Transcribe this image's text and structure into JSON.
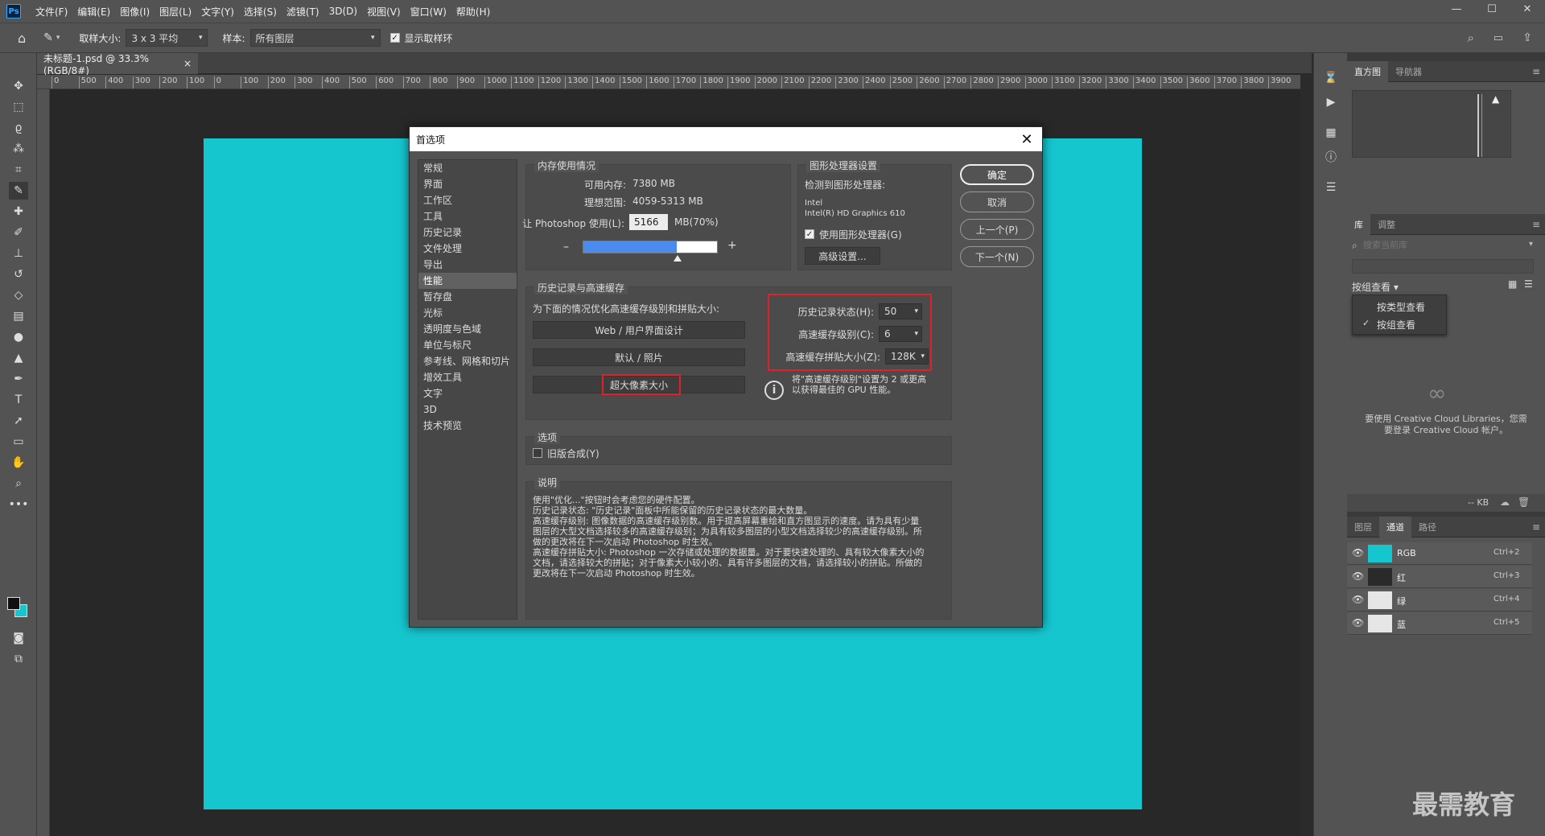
{
  "app": {
    "logo": "Ps",
    "menu": [
      "文件(F)",
      "编辑(E)",
      "图像(I)",
      "图层(L)",
      "文字(Y)",
      "选择(S)",
      "滤镜(T)",
      "3D(D)",
      "视图(V)",
      "窗口(W)",
      "帮助(H)"
    ]
  },
  "window_controls": {
    "minimize": "—",
    "maximize": "☐",
    "close": "✕"
  },
  "options": {
    "sample_size_label": "取样大小:",
    "sample_size_value": "3 x 3 平均",
    "sample_label": "样本:",
    "sample_value": "所有图层",
    "show_ring_label": "显示取样环"
  },
  "document_tab": {
    "title": "未标题-1.psd @ 33.3%(RGB/8#)",
    "close": "×"
  },
  "ruler_labels": [
    "0",
    "500",
    "400",
    "300",
    "200",
    "100",
    "0",
    "100",
    "200",
    "300",
    "400",
    "500",
    "600",
    "700",
    "800",
    "900",
    "1000",
    "1100",
    "1200",
    "1300",
    "1400",
    "1500",
    "1600",
    "1700",
    "1800",
    "1900",
    "2000",
    "2100",
    "2200",
    "2300",
    "2400",
    "2500",
    "2600",
    "2700",
    "2800",
    "2900",
    "3000",
    "3100",
    "3200",
    "3300",
    "3400",
    "3500",
    "3600",
    "3700",
    "3800",
    "3900"
  ],
  "canvas_color": "#16c6cf",
  "dialog": {
    "title": "首选项",
    "categories": [
      "常规",
      "界面",
      "工作区",
      "工具",
      "历史记录",
      "文件处理",
      "导出",
      "性能",
      "暂存盘",
      "光标",
      "透明度与色域",
      "单位与标尺",
      "参考线、网格和切片",
      "增效工具",
      "文字",
      "3D",
      "技术预览"
    ],
    "active_category": 7,
    "memory": {
      "legend": "内存使用情况",
      "available_label": "可用内存:",
      "available_value": "7380 MB",
      "ideal_label": "理想范围:",
      "ideal_value": "4059-5313 MB",
      "use_label": "让 Photoshop 使用(L):",
      "use_value": "5166",
      "use_unit": "MB(70%)",
      "minus": "–",
      "plus": "+",
      "slider_percent": 70
    },
    "gpu": {
      "legend": "图形处理器设置",
      "detected_label": "检测到图形处理器:",
      "vendor": "Intel",
      "model": "Intel(R) HD Graphics 610",
      "use_gpu_label": "使用图形处理器(G)",
      "advanced_button": "高级设置..."
    },
    "history_cache": {
      "legend": "历史记录与高速缓存",
      "optimize_label": "为下面的情况优化高速缓存级别和拼贴大小:",
      "presets": [
        "Web / 用户界面设计",
        "默认 / 照片",
        "超大像素大小"
      ],
      "history_states_label": "历史记录状态(H):",
      "history_states_value": "50",
      "cache_levels_label": "高速缓存级别(C):",
      "cache_levels_value": "6",
      "tile_size_label": "高速缓存拼贴大小(Z):",
      "tile_size_value": "128K",
      "info_text": "将\"高速缓存级别\"设置为 2 或更高以获得最佳的 GPU 性能。",
      "info_icon": "info-icon"
    },
    "options": {
      "legend": "选项",
      "legacy_label": "旧版合成(Y)"
    },
    "description": {
      "legend": "说明",
      "text": "使用\"优化...\"按钮时会考虑您的硬件配置。\n历史记录状态: \"历史记录\"面板中所能保留的历史记录状态的最大数量。\n高速缓存级别: 图像数据的高速缓存级别数。用于提高屏幕重绘和直方图显示的速度。请为具有少量图层的大型文档选择较多的高速缓存级别；为具有较多图层的小型文档选择较少的高速缓存级别。所做的更改将在下一次启动 Photoshop 时生效。\n高速缓存拼贴大小: Photoshop 一次存储或处理的数据量。对于要快速处理的、具有较大像素大小的文档，请选择较大的拼贴；对于像素大小较小的、具有许多图层的文档，请选择较小的拼贴。所做的更改将在下一次启动 Photoshop 时生效。"
    },
    "buttons": {
      "ok": "确定",
      "cancel": "取消",
      "prev": "上一个(P)",
      "next": "下一个(N)"
    }
  },
  "right_panels": {
    "histogram_tabs": [
      "直方图",
      "导航器"
    ],
    "library_tabs": [
      "库",
      "调整"
    ],
    "library_search_placeholder": "搜索当前库",
    "view_by_label": "按组查看",
    "view_menu": [
      "按类型查看",
      "按组查看"
    ],
    "library_message": "要使用 Creative Cloud Libraries，您需要登录 Creative Cloud 帐户。",
    "kb_label": "-- KB",
    "layer_tabs": [
      "图层",
      "通道",
      "路径"
    ],
    "channels": [
      {
        "name": "RGB",
        "shortcut": "Ctrl+2",
        "color": "#16c6cf"
      },
      {
        "name": "红",
        "shortcut": "Ctrl+3",
        "color": "#2a2a2a"
      },
      {
        "name": "绿",
        "shortcut": "Ctrl+4",
        "color": "#e6e6e6"
      },
      {
        "name": "蓝",
        "shortcut": "Ctrl+5",
        "color": "#e6e6e6"
      }
    ]
  },
  "watermark": "最需教育"
}
